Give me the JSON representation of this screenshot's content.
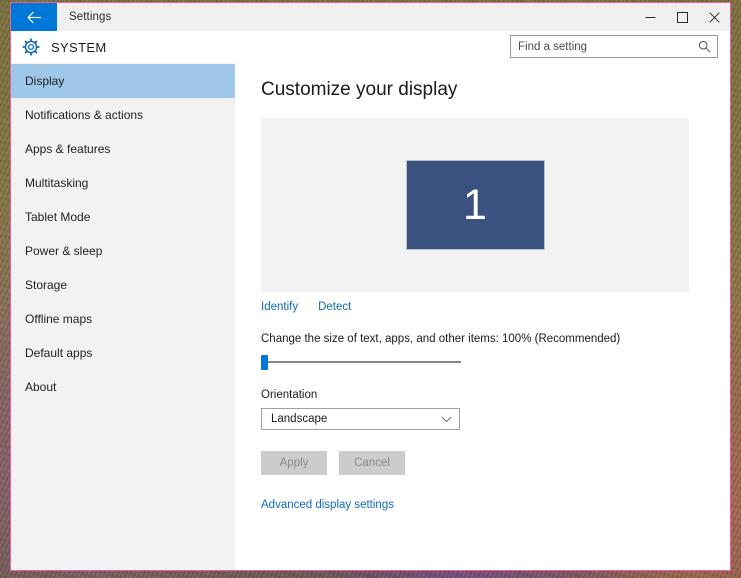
{
  "window": {
    "app_title": "Settings",
    "back_icon": "back-arrow-icon",
    "controls": {
      "minimize": "minimize-icon",
      "maximize": "maximize-icon",
      "close": "close-icon"
    }
  },
  "header": {
    "gear_icon": "gear-icon",
    "category_title": "SYSTEM",
    "search": {
      "placeholder": "Find a setting",
      "value": "",
      "icon": "search-icon"
    }
  },
  "sidebar": {
    "items": [
      {
        "label": "Display",
        "selected": true
      },
      {
        "label": "Notifications & actions",
        "selected": false
      },
      {
        "label": "Apps & features",
        "selected": false
      },
      {
        "label": "Multitasking",
        "selected": false
      },
      {
        "label": "Tablet Mode",
        "selected": false
      },
      {
        "label": "Power & sleep",
        "selected": false
      },
      {
        "label": "Storage",
        "selected": false
      },
      {
        "label": "Offline maps",
        "selected": false
      },
      {
        "label": "Default apps",
        "selected": false
      },
      {
        "label": "About",
        "selected": false
      }
    ]
  },
  "main": {
    "heading": "Customize your display",
    "monitor": {
      "number": "1"
    },
    "identify_link": "Identify",
    "detect_link": "Detect",
    "scale_label": "Change the size of text, apps, and other items: 100% (Recommended)",
    "scale_value": "100%",
    "orientation_label": "Orientation",
    "orientation_value": "Landscape",
    "orientation_chevron": "chevron-down-icon",
    "apply_button": "Apply",
    "cancel_button": "Cancel",
    "advanced_link": "Advanced display settings"
  },
  "colors": {
    "accent_blue": "#0078d7",
    "link_blue": "#0f6cbd",
    "sidebar_selected": "#9fc8e8",
    "sidebar_bg": "#f2f2f2",
    "monitor_fill": "#3b5280",
    "window_border": "#e85fa8",
    "button_disabled": "#cccccc"
  }
}
